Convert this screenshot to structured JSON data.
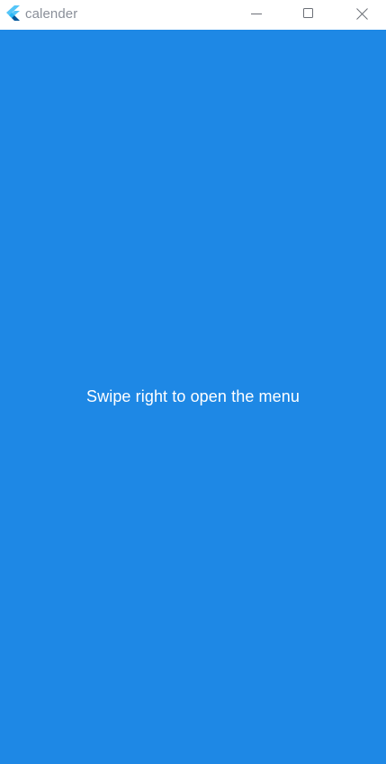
{
  "window": {
    "title": "calender",
    "app_icon": "flutter-logo-icon",
    "controls": {
      "minimize": "minimize-icon",
      "maximize": "maximize-icon",
      "close": "close-icon"
    }
  },
  "main": {
    "background_color": "#1e88e5",
    "hint_text": "Swipe right to open the menu"
  }
}
